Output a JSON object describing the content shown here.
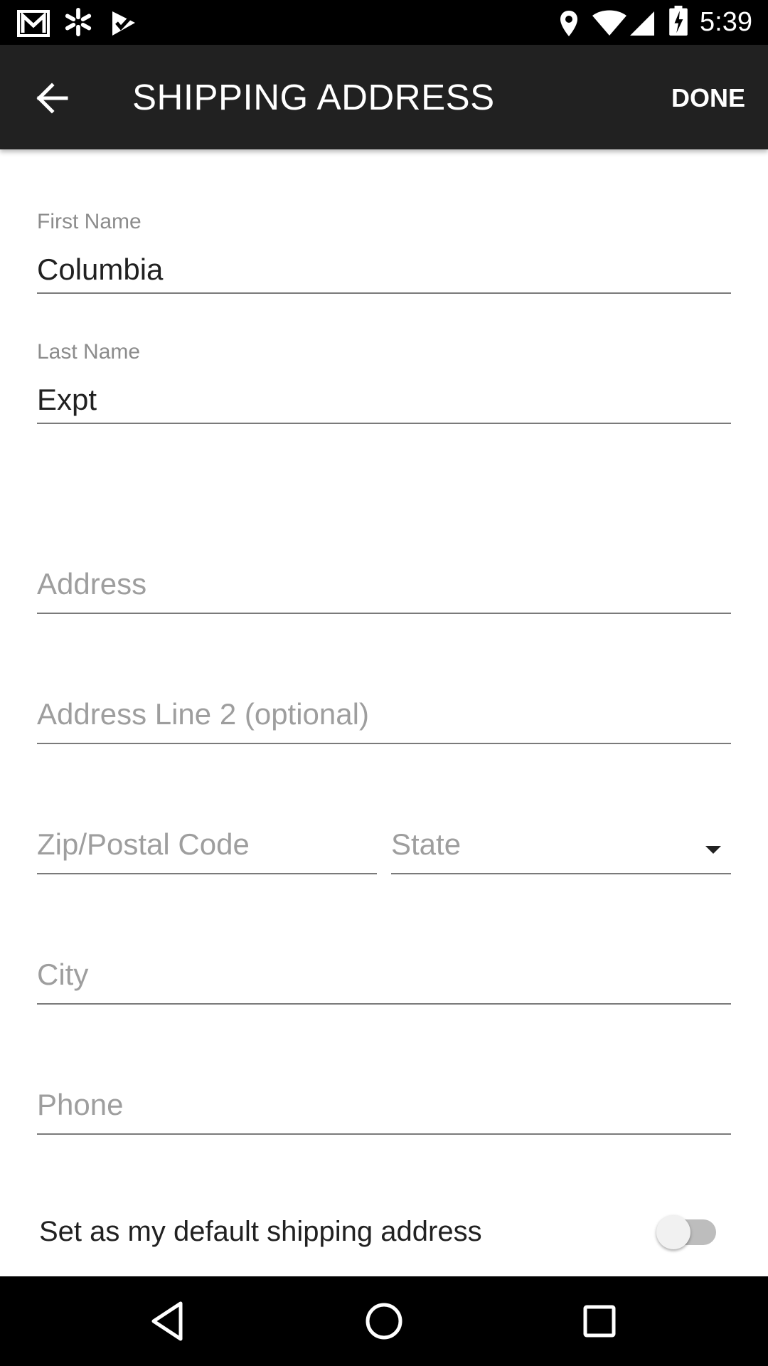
{
  "status_bar": {
    "time": "5:39",
    "left_icons": [
      "gmail-icon",
      "walmart-spark-icon",
      "check-flag-icon"
    ],
    "right_icons": [
      "location-icon",
      "wifi-icon",
      "signal-icon",
      "battery-charging-icon"
    ]
  },
  "app_bar": {
    "title": "SHIPPING ADDRESS",
    "done_label": "DONE",
    "back_icon": "arrow-back-icon"
  },
  "form": {
    "first_name": {
      "label": "First Name",
      "value": "Columbia"
    },
    "last_name": {
      "label": "Last Name",
      "value": "Expt"
    },
    "address": {
      "placeholder": "Address",
      "value": ""
    },
    "address2": {
      "placeholder": "Address Line 2 (optional)",
      "value": ""
    },
    "zip": {
      "placeholder": "Zip/Postal Code",
      "value": ""
    },
    "state": {
      "placeholder": "State",
      "value": ""
    },
    "city": {
      "placeholder": "City",
      "value": ""
    },
    "phone": {
      "placeholder": "Phone",
      "value": ""
    },
    "default_address": {
      "label": "Set as my default shipping address",
      "checked": false
    }
  },
  "nav_bar": {
    "buttons": [
      "back-triangle-icon",
      "home-circle-icon",
      "recents-square-icon"
    ]
  },
  "colors": {
    "app_bar": "#212121",
    "status_bar": "#000000",
    "text": "#212121",
    "hint": "#9e9e9e"
  }
}
